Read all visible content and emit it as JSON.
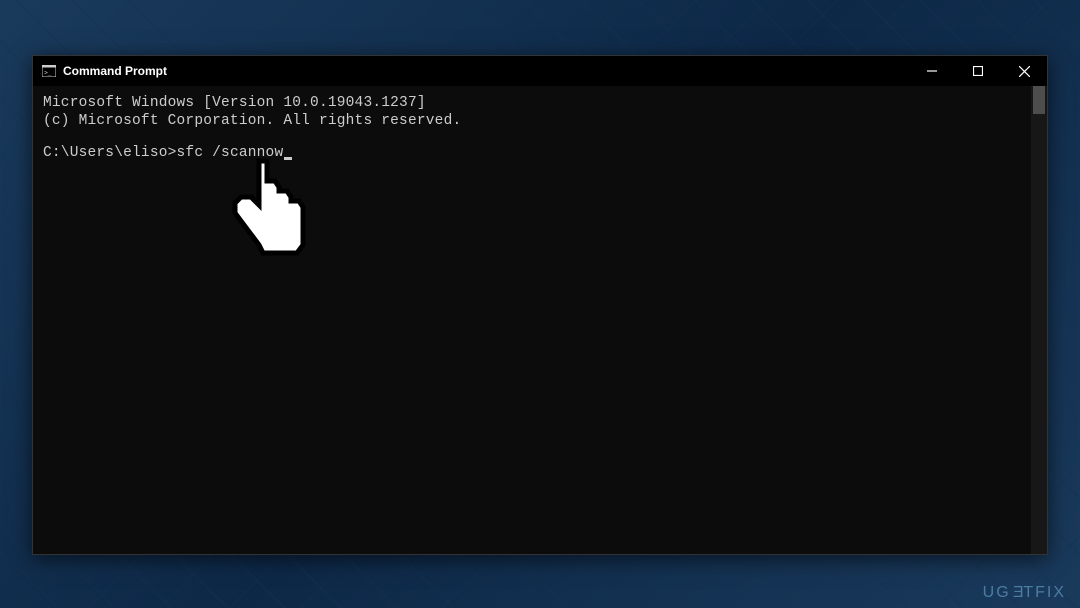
{
  "window": {
    "title": "Command Prompt"
  },
  "terminal": {
    "line1": "Microsoft Windows [Version 10.0.19043.1237]",
    "line2": "(c) Microsoft Corporation. All rights reserved.",
    "prompt": "C:\\Users\\eliso>",
    "command": "sfc /scannow"
  },
  "watermark": {
    "text": "UGETFIX"
  }
}
